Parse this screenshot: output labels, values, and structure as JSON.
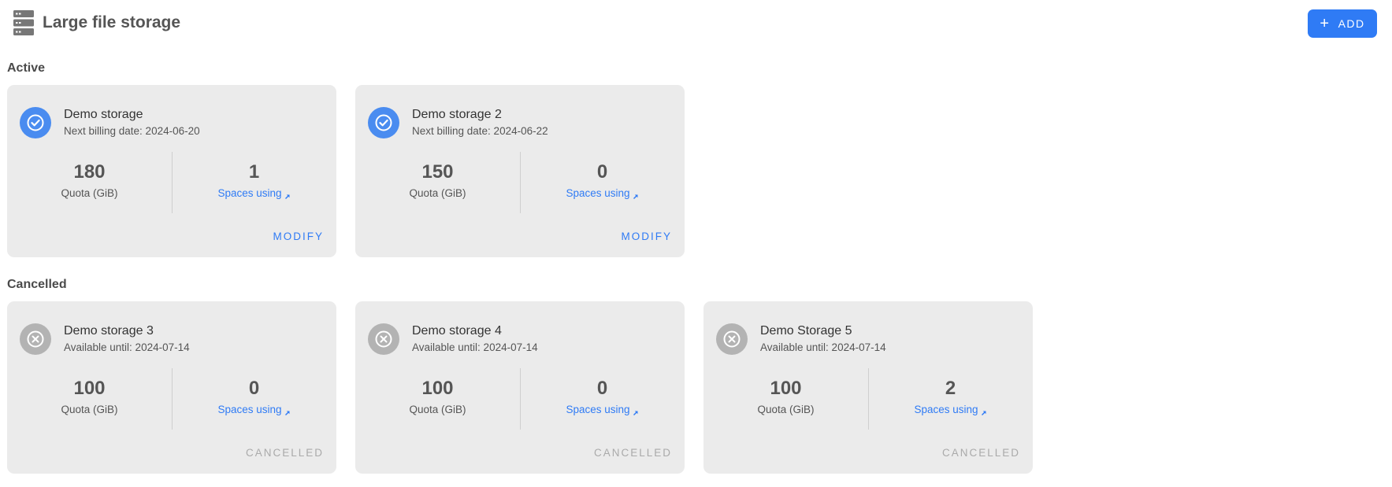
{
  "header": {
    "title": "Large file storage",
    "icon": "server-icon",
    "add_label": "ADD",
    "add_icon": "plus-icon"
  },
  "colors": {
    "accent": "#2f7bf5",
    "active_status": "#4a8cf0",
    "cancelled_status": "#b3b3b3",
    "card_background": "#ebebeb"
  },
  "sections": {
    "active": {
      "label": "Active",
      "cards": [
        {
          "name": "Demo storage",
          "date_text": "Next billing date: 2024-06-20",
          "quota": "180",
          "quota_label": "Quota (GiB)",
          "spaces": "1",
          "spaces_label": "Spaces using",
          "action": "MODIFY",
          "status_icon": "check-circle-icon"
        },
        {
          "name": "Demo storage 2",
          "date_text": "Next billing date: 2024-06-22",
          "quota": "150",
          "quota_label": "Quota (GiB)",
          "spaces": "0",
          "spaces_label": "Spaces using",
          "action": "MODIFY",
          "status_icon": "check-circle-icon"
        }
      ]
    },
    "cancelled": {
      "label": "Cancelled",
      "cards": [
        {
          "name": "Demo storage 3",
          "date_text": "Available until: 2024-07-14",
          "quota": "100",
          "quota_label": "Quota (GiB)",
          "spaces": "0",
          "spaces_label": "Spaces using",
          "action": "CANCELLED",
          "status_icon": "x-circle-icon"
        },
        {
          "name": "Demo storage 4",
          "date_text": "Available until: 2024-07-14",
          "quota": "100",
          "quota_label": "Quota (GiB)",
          "spaces": "0",
          "spaces_label": "Spaces using",
          "action": "CANCELLED",
          "status_icon": "x-circle-icon"
        },
        {
          "name": "Demo Storage 5",
          "date_text": "Available until: 2024-07-14",
          "quota": "100",
          "quota_label": "Quota (GiB)",
          "spaces": "2",
          "spaces_label": "Spaces using",
          "action": "CANCELLED",
          "status_icon": "x-circle-icon"
        }
      ]
    }
  }
}
